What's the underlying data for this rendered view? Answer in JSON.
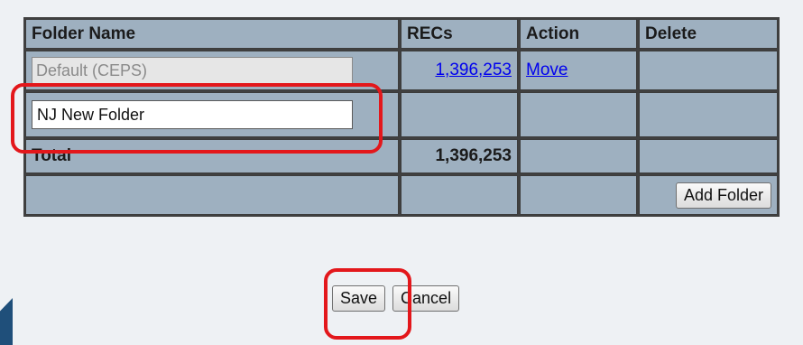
{
  "table": {
    "headers": {
      "folder_name": "Folder Name",
      "recs": "RECs",
      "action": "Action",
      "delete": "Delete"
    },
    "rows": [
      {
        "folder_name": "Default (CEPS)",
        "recs": "1,396,253",
        "action": "Move"
      },
      {
        "folder_name": "NJ New Folder"
      }
    ],
    "total": {
      "label": "Total",
      "recs": "1,396,253"
    },
    "add_folder_label": "Add Folder"
  },
  "buttons": {
    "save": "Save",
    "cancel": "Cancel"
  },
  "colors": {
    "highlight": "#e3171b",
    "cell_bg": "#9eb0c0",
    "link": "#0000ee"
  }
}
